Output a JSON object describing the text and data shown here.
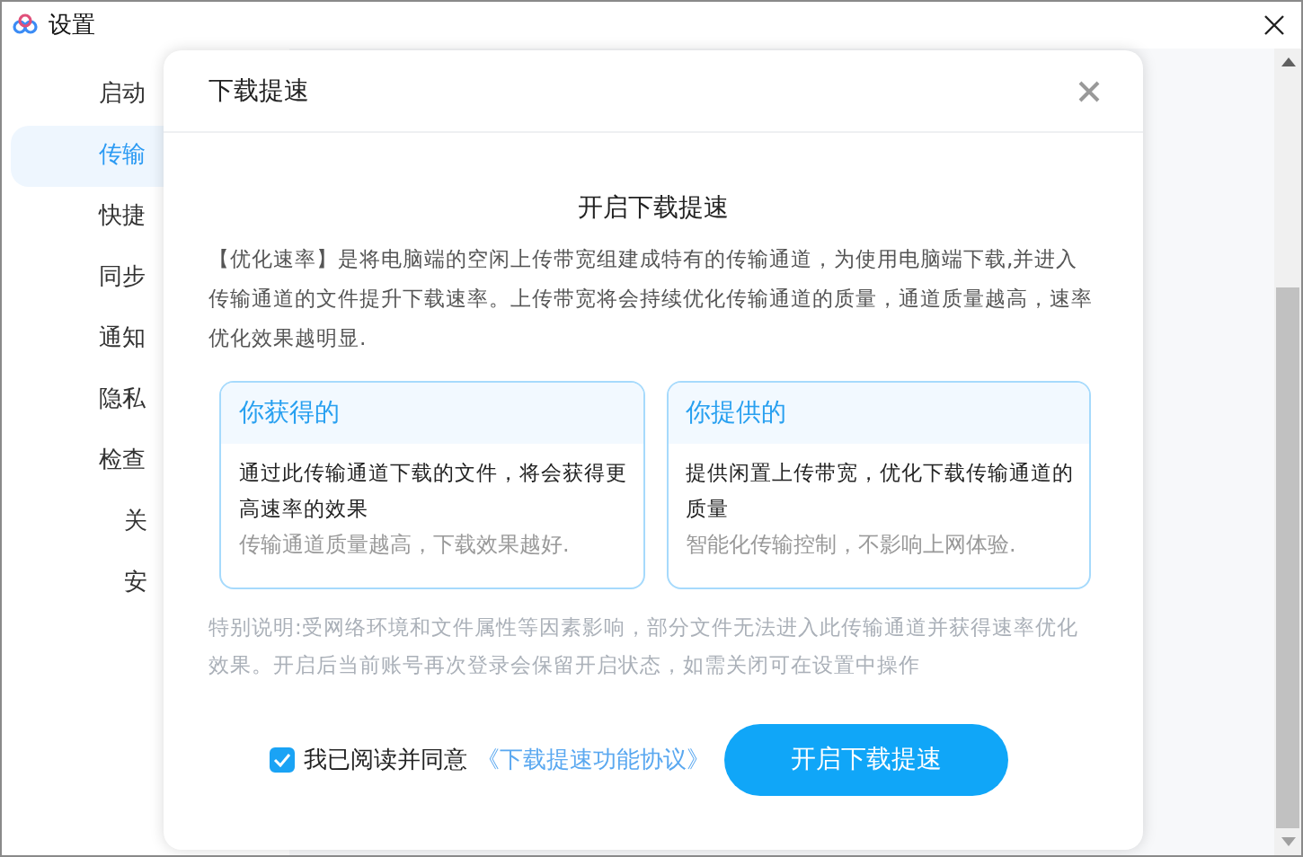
{
  "window": {
    "title": "设置"
  },
  "sidebar": {
    "items": [
      {
        "label": "启动",
        "selected": false
      },
      {
        "label": "传输",
        "selected": true
      },
      {
        "label": "快捷",
        "selected": false
      },
      {
        "label": "同步",
        "selected": false
      },
      {
        "label": "通知",
        "selected": false
      },
      {
        "label": "隐私",
        "selected": false
      },
      {
        "label": "检查",
        "selected": false,
        "children": [
          {
            "label": "关",
            "selected": false
          },
          {
            "label": "安",
            "selected": false
          }
        ]
      }
    ]
  },
  "dialog": {
    "title": "下载提速",
    "heading": "开启下载提速",
    "description": "【优化速率】是将电脑端的空闲上传带宽组建成特有的传输通道，为使用电脑端下载,并进入传输通道的文件提升下载速率。上传带宽将会持续优化传输通道的质量，通道质量越高，速率优化效果越明显.",
    "cards": [
      {
        "title": "你获得的",
        "text": "通过此传输通道下载的文件，将会获得更高速率的效果",
        "note": "传输通道质量越高，下载效果越好."
      },
      {
        "title": "你提供的",
        "text": "提供闲置上传带宽，优化下载传输通道的质量",
        "note": "智能化传输控制，不影响上网体验."
      }
    ],
    "notice": "特别说明:受网络环境和文件属性等因素影响，部分文件无法进入此传输通道并获得速率优化效果。开启后当前账号再次登录会保留开启状态，如需关闭可在设置中操作",
    "agreement": {
      "checked": true,
      "label": "我已阅读并同意",
      "link": "《下载提速功能协议》"
    },
    "confirm_button": "开启下载提速"
  }
}
